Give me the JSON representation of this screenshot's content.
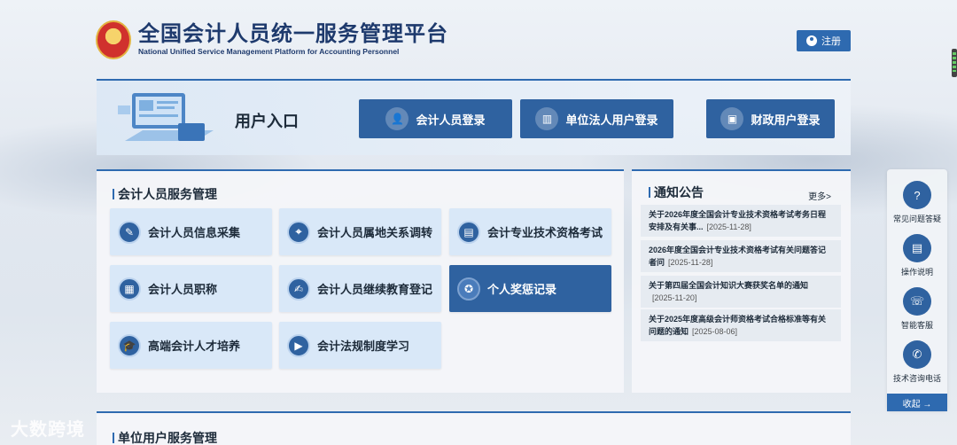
{
  "header": {
    "title_cn": "全国会计人员统一服务管理平台",
    "title_en": "National Unified Service Management Platform for Accounting Personnel",
    "register_label": "注册"
  },
  "entry": {
    "title": "用户入口",
    "buttons": [
      {
        "label": "会计人员登录",
        "icon": "person-icon"
      },
      {
        "label": "单位法人用户登录",
        "icon": "building-icon"
      },
      {
        "label": "财政用户登录",
        "icon": "id-card-icon"
      }
    ]
  },
  "services": {
    "title": "会计人员服务管理",
    "items": [
      {
        "label": "会计人员信息采集",
        "icon": "form-edit-icon"
      },
      {
        "label": "会计人员属地关系调转",
        "icon": "location-icon"
      },
      {
        "label": "会计专业技术资格考试",
        "icon": "printer-icon"
      },
      {
        "label": "会计人员职称",
        "icon": "certificate-icon"
      },
      {
        "label": "会计人员继续教育登记",
        "icon": "register-icon"
      },
      {
        "label": "个人奖惩记录",
        "icon": "award-icon"
      },
      {
        "label": "高端会计人才培养",
        "icon": "graduation-cap-icon"
      },
      {
        "label": "会计法规制度学习",
        "icon": "play-icon"
      }
    ]
  },
  "notices": {
    "title": "通知公告",
    "more_label": "更多>",
    "items": [
      {
        "text": "关于2026年度全国会计专业技术资格考试考务日程安排及有关事...",
        "date": "[2025-11-28]"
      },
      {
        "text": "2026年度全国会计专业技术资格考试有关问题答记者问",
        "date": "[2025-11-28]"
      },
      {
        "text": "关于第四届全国会计知识大赛获奖名单的通知",
        "date": "[2025-11-20]"
      },
      {
        "text": "关于2025年度高级会计师资格考试合格标准等有关问题的通知",
        "date": "[2025-08-06]"
      }
    ]
  },
  "float_bar": {
    "items": [
      {
        "label": "常见问题答疑",
        "icon": "question-icon"
      },
      {
        "label": "操作说明",
        "icon": "document-icon"
      },
      {
        "label": "智能客服",
        "icon": "chat-icon"
      },
      {
        "label": "技术咨询电话",
        "icon": "phone-icon"
      }
    ],
    "collapse_label": "收起 →"
  },
  "unit": {
    "title": "单位用户服务管理"
  },
  "watermark": "大数跨境",
  "colors": {
    "primary": "#2f62a0",
    "accent": "#2e6ab0",
    "tile": "#d9e8f8"
  }
}
